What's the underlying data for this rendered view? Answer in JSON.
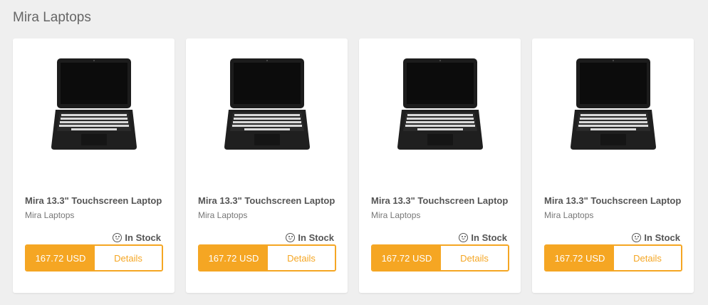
{
  "page": {
    "title": "Mira Laptops"
  },
  "products": [
    {
      "name": "Mira 13.3\" Touchscreen Laptop",
      "brand": "Mira Laptops",
      "stock": "In Stock",
      "price": "167.72 USD",
      "details_label": "Details"
    },
    {
      "name": "Mira 13.3\" Touchscreen Laptop",
      "brand": "Mira Laptops",
      "stock": "In Stock",
      "price": "167.72 USD",
      "details_label": "Details"
    },
    {
      "name": "Mira 13.3\" Touchscreen Laptop",
      "brand": "Mira Laptops",
      "stock": "In Stock",
      "price": "167.72 USD",
      "details_label": "Details"
    },
    {
      "name": "Mira 13.3\" Touchscreen Laptop",
      "brand": "Mira Laptops",
      "stock": "In Stock",
      "price": "167.72 USD",
      "details_label": "Details"
    }
  ],
  "colors": {
    "accent": "#f5a623",
    "background": "#efefef",
    "card": "#ffffff"
  },
  "icons": {
    "stock": "smiley-icon",
    "product_image": "laptop-image"
  }
}
